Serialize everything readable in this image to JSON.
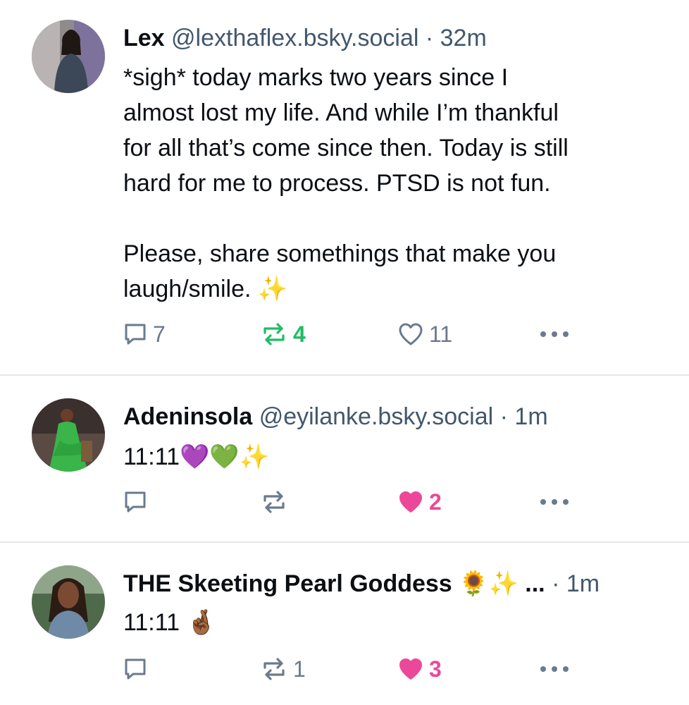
{
  "posts": [
    {
      "name": "Lex",
      "handle": "@lexthaflex.bsky.social",
      "separator": "·",
      "time": "32m",
      "text": "*sigh* today marks two years since I\nalmost lost my life. And while I’m thankful\nfor all that’s come since then. Today is still\nhard for me to process. PTSD is not fun.\n\nPlease, share somethings that make you\nlaugh/smile. ✨",
      "replies": "7",
      "reposts": "4",
      "likes": "11",
      "reposted": true,
      "liked": false
    },
    {
      "name": "Adeninsola",
      "handle": "@eyilanke.bsky.social",
      "separator": "·",
      "time": "1m",
      "text": "11:11💜💚✨",
      "replies": "",
      "reposts": "",
      "likes": "2",
      "reposted": false,
      "liked": true
    },
    {
      "name": "THE Skeeting Pearl Goddess 🌻✨ ...",
      "handle": "",
      "separator": "·",
      "time": "1m",
      "text": "11:11 🤞🏾",
      "replies": "",
      "reposts": "1",
      "likes": "3",
      "reposted": false,
      "liked": true
    }
  ],
  "colors": {
    "accent_green": "#20bc65",
    "accent_pink": "#ec4899",
    "muted": "#6b7a8c",
    "divider": "#e3e6ea"
  },
  "icons": {
    "reply": "speech-bubble-icon",
    "repost": "repost-arrows-icon",
    "like": "heart-icon",
    "more": "more-dots-icon"
  }
}
